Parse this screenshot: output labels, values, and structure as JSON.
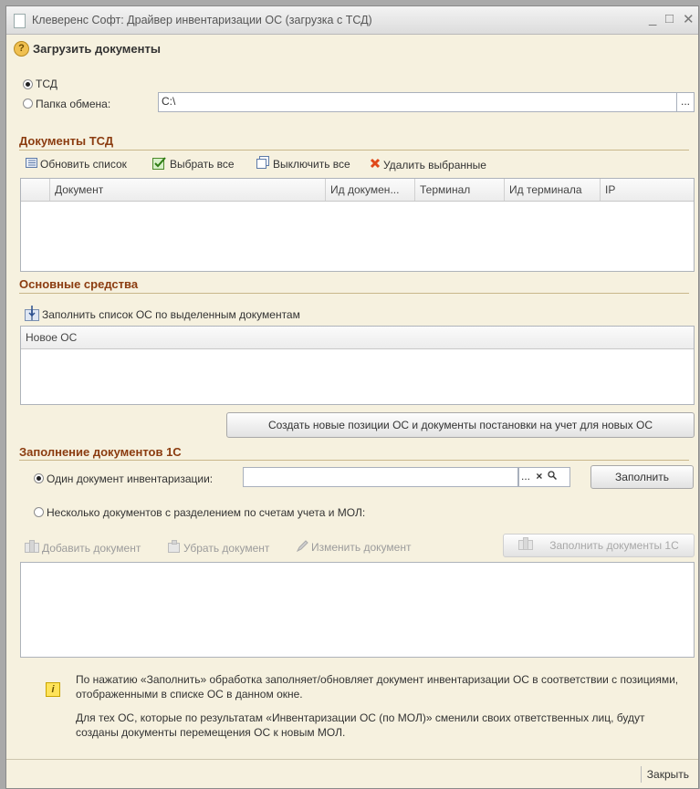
{
  "window": {
    "title": "Клеверенс Софт: Драйвер инвентаризации ОС (загрузка с ТСД)",
    "minimize": "_",
    "maximize": "□",
    "close": "✕"
  },
  "header": {
    "help_glyph": "?",
    "load_documents_label": "Загрузить документы"
  },
  "source": {
    "tsd_label": "ТСД",
    "folder_label": "Папка обмена:",
    "folder_value": "C:\\",
    "folder_browse": "..."
  },
  "tsd_documents": {
    "title": "Документы ТСД",
    "toolbar": {
      "refresh": "Обновить список",
      "select_all": "Выбрать все",
      "deselect_all": "Выключить все",
      "delete_selected": "Удалить выбранные"
    },
    "columns": [
      "Документ",
      "Ид докумен...",
      "Терминал",
      "Ид терминала",
      "IP"
    ]
  },
  "fixed_assets": {
    "title": "Основные средства",
    "fill_button": "Заполнить список ОС по выделенным документам",
    "columns": [
      "Новое ОС"
    ],
    "create_button": "Создать новые позиции ОС и документы постановки на учет для новых ОС"
  },
  "fill_1c": {
    "title": "Заполнение документов 1С",
    "single_label": "Один документ инвентаризации:",
    "single_value": "",
    "single_dots": "...",
    "single_clear": "×",
    "fill_button": "Заполнить",
    "multiple_label": "Несколько документов с разделением по счетам учета и МОЛ:",
    "toolbar": {
      "add": "Добавить документ",
      "remove": "Убрать документ",
      "edit": "Изменить документ"
    },
    "fill_docs_button": "Заполнить документы 1С"
  },
  "info": {
    "glyph": "i",
    "paragraph1": "По нажатию «Заполнить» обработка заполняет/обновляет документ инвентаризации ОС в соответствии с позициями, отображенными в списке ОС в данном окне.",
    "paragraph2": "Для тех ОС, которые по результатам «Инвентаризации ОС (по МОЛ)» сменили своих ответственных лиц, будут созданы документы перемещения ОС к новым МОЛ."
  },
  "footer": {
    "close_label": "Закрыть"
  }
}
